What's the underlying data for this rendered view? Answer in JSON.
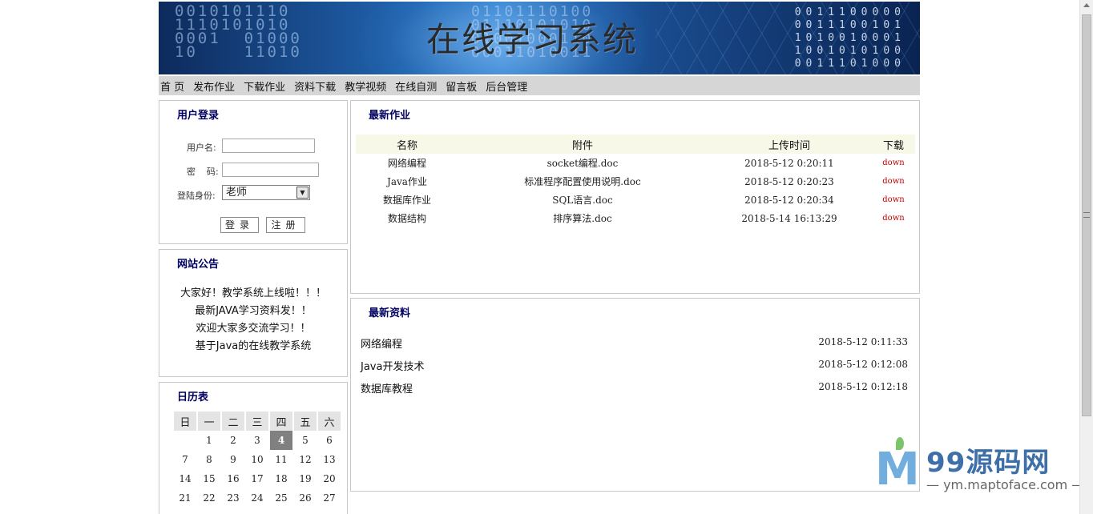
{
  "banner": {
    "title": "在线学习系统",
    "bits_left": "0010101110\n1110101010\n0001  01000\n10    11010",
    "bits_mid": "01101110100\n01110101010\n01001000110\n00011010011",
    "bits_right": "0011100000\n0011100101\n1010010001\n1001010100\n0011101000"
  },
  "nav": [
    "首 页",
    "发布作业",
    "下载作业",
    "资料下载",
    "教学视频",
    "在线自测",
    "留言板",
    "后台管理"
  ],
  "login": {
    "title": "用户登录",
    "username_label": "用户名:",
    "password_label": "密    码:",
    "role_label": "登陆身份:",
    "role_value": "老师",
    "login_button": "登录",
    "register_button": "注册"
  },
  "notice": {
    "title": "网站公告",
    "items": [
      "大家好！教学系统上线啦！！！",
      "最新JAVA学习资料发！！",
      "欢迎大家多交流学习！！",
      "基于Java的在线教学系统"
    ]
  },
  "calendar": {
    "title": "日历表",
    "weekdays": [
      "日",
      "一",
      "二",
      "三",
      "四",
      "五",
      "六"
    ],
    "weeks": [
      [
        "",
        "1",
        "2",
        "3",
        "4",
        "5",
        "6"
      ],
      [
        "7",
        "8",
        "9",
        "10",
        "11",
        "12",
        "13"
      ],
      [
        "14",
        "15",
        "16",
        "17",
        "18",
        "19",
        "20"
      ],
      [
        "21",
        "22",
        "23",
        "24",
        "25",
        "26",
        "27"
      ]
    ],
    "today": "4"
  },
  "homework": {
    "title": "最新作业",
    "columns": [
      "名称",
      "附件",
      "上传时间",
      "下载"
    ],
    "rows": [
      {
        "name": "网络编程",
        "file": "socket编程.doc",
        "time": "2018-5-12 0:20:11",
        "link": "down"
      },
      {
        "name": "Java作业",
        "file": "标准程序配置使用说明.doc",
        "time": "2018-5-12 0:20:23",
        "link": "down"
      },
      {
        "name": "数据库作业",
        "file": "SQL语言.doc",
        "time": "2018-5-12 0:20:34",
        "link": "down"
      },
      {
        "name": "数据结构",
        "file": "排序算法.doc",
        "time": "2018-5-14 16:13:29",
        "link": "down"
      }
    ]
  },
  "materials": {
    "title": "最新资料",
    "items": [
      {
        "name": "网络编程",
        "time": "2018-5-12 0:11:33"
      },
      {
        "name": "Java开发技术",
        "time": "2018-5-12 0:12:08"
      },
      {
        "name": "数据库教程",
        "time": "2018-5-12 0:12:18"
      }
    ]
  },
  "watermark": {
    "brand": "99源码网",
    "subtitle": "— ym.maptoface.com —"
  }
}
